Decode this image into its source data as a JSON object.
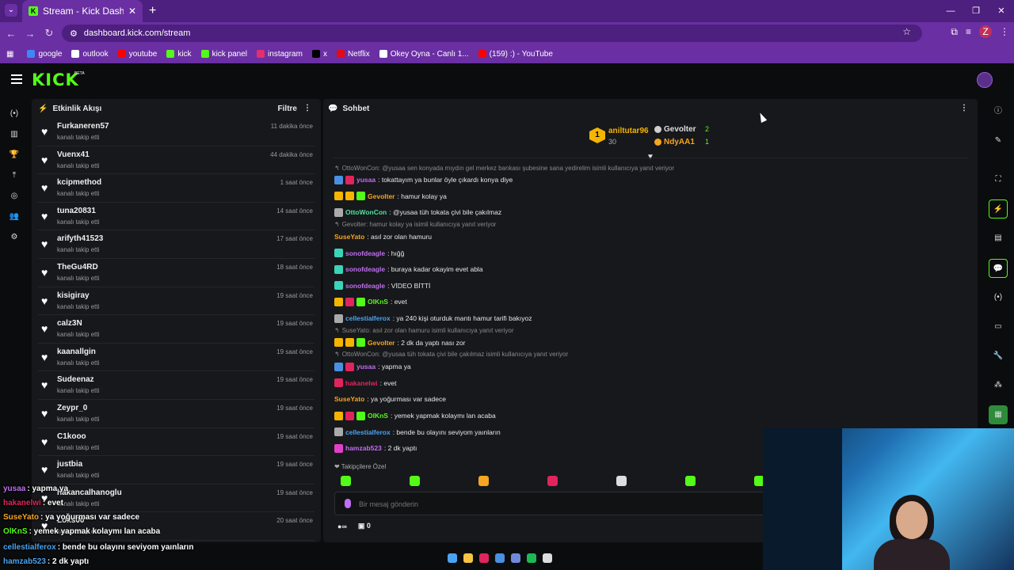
{
  "browser": {
    "tab_title": "Stream - Kick Dashboard",
    "url": "dashboard.kick.com/stream",
    "profile_initial": "Z",
    "bookmarks": [
      {
        "label": "google",
        "color": "#4285f4"
      },
      {
        "label": "outlook",
        "color": "#ffffff"
      },
      {
        "label": "youtube",
        "color": "#ff0000"
      },
      {
        "label": "kick",
        "color": "#53fc18"
      },
      {
        "label": "kick panel",
        "color": "#53fc18"
      },
      {
        "label": "instagram",
        "color": "#e1306c"
      },
      {
        "label": "x",
        "color": "#000000"
      },
      {
        "label": "Netflix",
        "color": "#e50914"
      },
      {
        "label": "Okey Oyna - Canlı 1...",
        "color": "#ffffff"
      },
      {
        "label": "(159) :) - YouTube",
        "color": "#ff0000"
      }
    ]
  },
  "kick": {
    "logo": "KICK",
    "beta": "BETA"
  },
  "activity": {
    "title": "Etkinlik Akışı",
    "filter": "Filtre",
    "items": [
      {
        "name": "Furkaneren57",
        "action": "kanalı takip etti",
        "time": "11 dakika önce"
      },
      {
        "name": "Vuenx41",
        "action": "kanalı takip etti",
        "time": "44 dakika önce"
      },
      {
        "name": "kcipmethod",
        "action": "kanalı takip etti",
        "time": "1 saat önce"
      },
      {
        "name": "tuna20831",
        "action": "kanalı takip etti",
        "time": "14 saat önce"
      },
      {
        "name": "arifyth41523",
        "action": "kanalı takip etti",
        "time": "17 saat önce"
      },
      {
        "name": "TheGu4RD",
        "action": "kanalı takip etti",
        "time": "18 saat önce"
      },
      {
        "name": "kisigiray",
        "action": "kanalı takip etti",
        "time": "19 saat önce"
      },
      {
        "name": "calz3N",
        "action": "kanalı takip etti",
        "time": "19 saat önce"
      },
      {
        "name": "kaanallgin",
        "action": "kanalı takip etti",
        "time": "19 saat önce"
      },
      {
        "name": "Sudeenaz",
        "action": "kanalı takip etti",
        "time": "19 saat önce"
      },
      {
        "name": "Zeypr_0",
        "action": "kanalı takip etti",
        "time": "19 saat önce"
      },
      {
        "name": "C1kooo",
        "action": "kanalı takip etti",
        "time": "19 saat önce"
      },
      {
        "name": "justbia",
        "action": "kanalı takip etti",
        "time": "19 saat önce"
      },
      {
        "name": "hakancalhanoglu",
        "action": "kanalı takip etti",
        "time": "19 saat önce"
      },
      {
        "name": "Loxs00",
        "action": "kanalı takip etti",
        "time": "20 saat önce"
      }
    ]
  },
  "chat": {
    "title": "Sohbet",
    "leaderboard": {
      "first": {
        "name": "aniltutar96",
        "count": "30",
        "rank": "1"
      },
      "second": {
        "name": "Gevolter",
        "count": "2"
      },
      "third": {
        "name": "NdyAA1",
        "count": "1"
      }
    },
    "messages": [
      {
        "reply": true,
        "text": "OttoWonCon: @yusaa sen konyada mıydın gel merkez bankası şubesine sana yedirelim isimli kullanıcıya yanıt veriyor"
      },
      {
        "user": "yusaa",
        "color": "#c06ef2",
        "badges": [
          "#4a90e2",
          "#e0245e"
        ],
        "text": ": tokattayım ya bunlar öyle çıkardı konya diye"
      },
      {
        "user": "Gevolter",
        "color": "#f5a623",
        "badges": [
          "#f5b400",
          "#f5b400",
          "#53fc18"
        ],
        "text": ": hamur kolay ya"
      },
      {
        "user": "OttoWonCon",
        "color": "#53e0a0",
        "badges": [
          "#aaaaaa"
        ],
        "text": ": @yusaa tüh tokata çivi bile çakılmaz"
      },
      {
        "reply": true,
        "text": "Gevolter: hamur kolay ya isimli kullanıcıya yanıt veriyor"
      },
      {
        "user": "SuseYato",
        "color": "#f5a623",
        "badges": [],
        "text": ": asıl zor olan hamuru"
      },
      {
        "user": "sonofdeagle",
        "color": "#c06ef2",
        "badges": [
          "#3ad4b8"
        ],
        "text": ": hığğ"
      },
      {
        "user": "sonofdeagle",
        "color": "#c06ef2",
        "badges": [
          "#3ad4b8"
        ],
        "text": ": buraya kadar okayim evet abla"
      },
      {
        "user": "sonofdeagle",
        "color": "#c06ef2",
        "badges": [
          "#3ad4b8"
        ],
        "text": ": VİDEO BİTTİ"
      },
      {
        "user": "OlKnS",
        "color": "#53fc18",
        "badges": [
          "#f5b400",
          "#e0245e",
          "#53fc18"
        ],
        "text": ": evet"
      },
      {
        "user": "cellestialferox",
        "color": "#4aa3f0",
        "badges": [
          "#aaaaaa"
        ],
        "text": ": ya 240 kişi oturduk mantı hamur tarifi bakıyoz"
      },
      {
        "reply": true,
        "text": "SuseYato: asıl zor olan hamuru isimli kullanıcıya yanıt veriyor"
      },
      {
        "user": "Gevolter",
        "color": "#f5a623",
        "badges": [
          "#f5b400",
          "#f5b400",
          "#53fc18"
        ],
        "text": ": 2 dk da yaptı nası zor"
      },
      {
        "reply": true,
        "text": "OttoWonCon: @yusaa tüh tokata çivi bile çakılmaz isimli kullanıcıya yanıt veriyor"
      },
      {
        "user": "yusaa",
        "color": "#c06ef2",
        "badges": [
          "#4a90e2",
          "#e0245e"
        ],
        "text": ": yapma ya"
      },
      {
        "user": "hakanelwi",
        "color": "#e0245e",
        "badges": [
          "#e0245e"
        ],
        "text": ": evet"
      },
      {
        "user": "SuseYato",
        "color": "#f5a623",
        "badges": [],
        "text": ": ya yoğurması var sadece"
      },
      {
        "user": "OlKnS",
        "color": "#53fc18",
        "badges": [
          "#f5b400",
          "#e0245e",
          "#53fc18"
        ],
        "text": ": yemek yapmak kolaymı lan acaba"
      },
      {
        "user": "cellestialferox",
        "color": "#4aa3f0",
        "badges": [
          "#aaaaaa"
        ],
        "text": ": bende bu olayını seviyom yaınların"
      },
      {
        "user": "hamzab523",
        "color": "#c06ef2",
        "badges": [
          "#e040c8"
        ],
        "text": ": 2 dk yaptı"
      }
    ],
    "subscriber_only": "Takipçilere Özel",
    "emote_colors": [
      "#53fc18",
      "#53fc18",
      "#f5a623",
      "#e0245e",
      "#dddddd",
      "#53fc18",
      "#53fc18"
    ],
    "input_placeholder": "Bir mesaj gönderin",
    "bottom_left": "∞",
    "bottom_right": "0"
  },
  "overlay": [
    {
      "user": "yusaa",
      "color": "#c06ef2",
      "text": ": yapma ya"
    },
    {
      "user": "hakanelwi",
      "color": "#e0245e",
      "text": ": evet"
    },
    {
      "user": "SuseYato",
      "color": "#f5a623",
      "text": ": ya yoğurması var sadece"
    },
    {
      "user": "OlKnS",
      "color": "#53fc18",
      "text": ": yemek yapmak kolaymı lan acaba"
    },
    {
      "user": "cellestialferox",
      "color": "#4aa3f0",
      "text": ": bende bu olayını seviyom yaınların"
    },
    {
      "user": "hamzab523",
      "color": "#4aa3f0",
      "text": ": 2 dk yaptı"
    }
  ],
  "taskbar_colors": [
    "#4aa3f0",
    "#f5c542",
    "#e0245e",
    "#4a90e2",
    "#7289da",
    "#1db954",
    "#dddddd"
  ]
}
